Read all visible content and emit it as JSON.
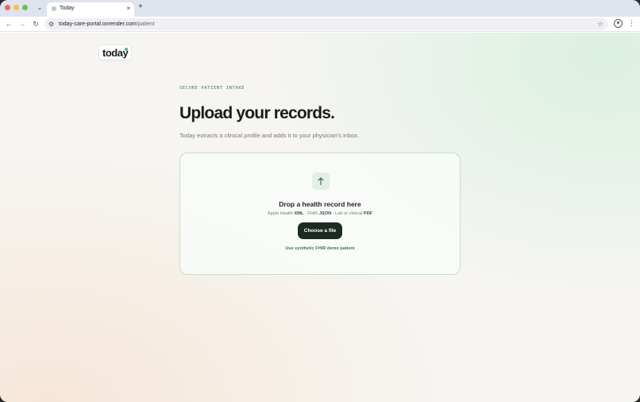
{
  "browser": {
    "tab": {
      "title": "Today",
      "close": "×"
    },
    "new_tab": "+",
    "tab_list": "⌄",
    "nav": {
      "back": "←",
      "forward": "→",
      "reload": "↻"
    },
    "url": {
      "host": "today-care-portal.onrender.com",
      "path": "/patient"
    },
    "site_info": "⚙",
    "bookmark": "☆",
    "menu": "⋮"
  },
  "page": {
    "logo": "today",
    "eyebrow": "SECURE PATIENT INTAKE",
    "headline": "Upload your records.",
    "subhead": "Today extracts a clinical profile and adds it to your physician's inbox.",
    "dropzone": {
      "title": "Drop a health record here",
      "formats": {
        "apple_prefix": "Apple Health ",
        "apple_format": "XML",
        "sep1": " · FHIR ",
        "fhir_format": "JSON",
        "sep2": " · Lab or clinical ",
        "lab_format": "PDF"
      },
      "choose_button": "Choose a file",
      "demo_link": "Use synthetic FHIR demo patient"
    }
  },
  "colors": {
    "accent_green": "#3d7a5a",
    "button_dark": "#1b2a22",
    "logo_dot": "#57b07a"
  }
}
